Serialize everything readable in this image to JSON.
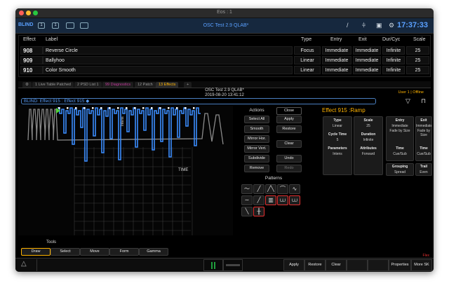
{
  "window": {
    "title": "Eos : 1",
    "show_name": "OSC Test 2.9 QLAB*",
    "clock": "17:37:33",
    "mode": "BLIND",
    "tb_buttons": [
      "1",
      "1"
    ]
  },
  "table": {
    "headers": [
      "Effect",
      "Label",
      "Type",
      "Entry",
      "Exit",
      "Dur/Cyc",
      "Scale"
    ],
    "rows": [
      {
        "effect": "908",
        "label": "Reverse Circle",
        "type": "Focus",
        "entry": "Immediate",
        "exit": "Immediate",
        "dur": "Infinite",
        "scale": "25"
      },
      {
        "effect": "909",
        "label": "Ballyhoo",
        "type": "Linear",
        "entry": "Immediate",
        "exit": "Immediate",
        "dur": "Infinite",
        "scale": "25"
      },
      {
        "effect": "910",
        "label": "Color Smooth",
        "type": "Linear",
        "entry": "Immediate",
        "exit": "Immediate",
        "dur": "Infinite",
        "scale": "25"
      }
    ]
  },
  "tabs": [
    "1 Live Table Patched",
    "2 PSD List 1",
    "99 Diagnostics",
    "12 Patch",
    "13 Effects",
    "+"
  ],
  "subheader": {
    "show": "OSC Test 2.9 QLAB*",
    "date": "2019-08-20 13:41:12",
    "user": "User 1 | Offline"
  },
  "command_line": "BLIND: Effect  915 :  Effect 915 ◆",
  "wave": {
    "axis_label": "TIME",
    "marker": "Intens"
  },
  "actions": {
    "title": "Actions",
    "items": [
      "Select All",
      "Smooth",
      "Mirror Hor.",
      "Mirror Vert.",
      "Subdivide",
      "Remove"
    ],
    "close": "Close",
    "side": [
      "Apply",
      "Restore",
      "Clear",
      "Undo",
      "Redo"
    ]
  },
  "patterns": {
    "title": "Patterns"
  },
  "effect_panel": {
    "title": "Effect  915 :Ramp",
    "fields": [
      {
        "label": "Type",
        "value": "Linear"
      },
      {
        "label": "Scale",
        "value": "25"
      },
      {
        "label": "Cycle Time",
        "value": "5"
      },
      {
        "label": "Duration",
        "value": "Infinite"
      },
      {
        "label": "Parameters",
        "value": "Intens"
      },
      {
        "label": "Attributes",
        "value": "Forward"
      }
    ],
    "entry": {
      "label": "Entry",
      "value": "Immediate",
      "sub": "Fade by Size"
    },
    "exit": {
      "label": "Exit",
      "value": "Immediate",
      "sub": "Fade by Size"
    },
    "entry_time": {
      "label": "Time",
      "value": "Cue/Sub"
    },
    "exit_time": {
      "label": "Time",
      "value": "Cue/Sub"
    },
    "grouping": {
      "label": "Grouping",
      "value": "Spread"
    },
    "trail": {
      "label": "Trail",
      "value": "Even"
    }
  },
  "tools": {
    "title": "Tools",
    "items": [
      "Draw",
      "Select",
      "Move",
      "Form",
      "Gamma"
    ]
  },
  "bottom": {
    "buttons": [
      "Apply",
      "Restore",
      "Clear",
      "",
      "",
      "Properties",
      "More SK"
    ],
    "flag": "Flex"
  },
  "colors": {
    "accent": "#ffb300",
    "blue": "#5aa0ff",
    "highlight": "#e53030"
  }
}
